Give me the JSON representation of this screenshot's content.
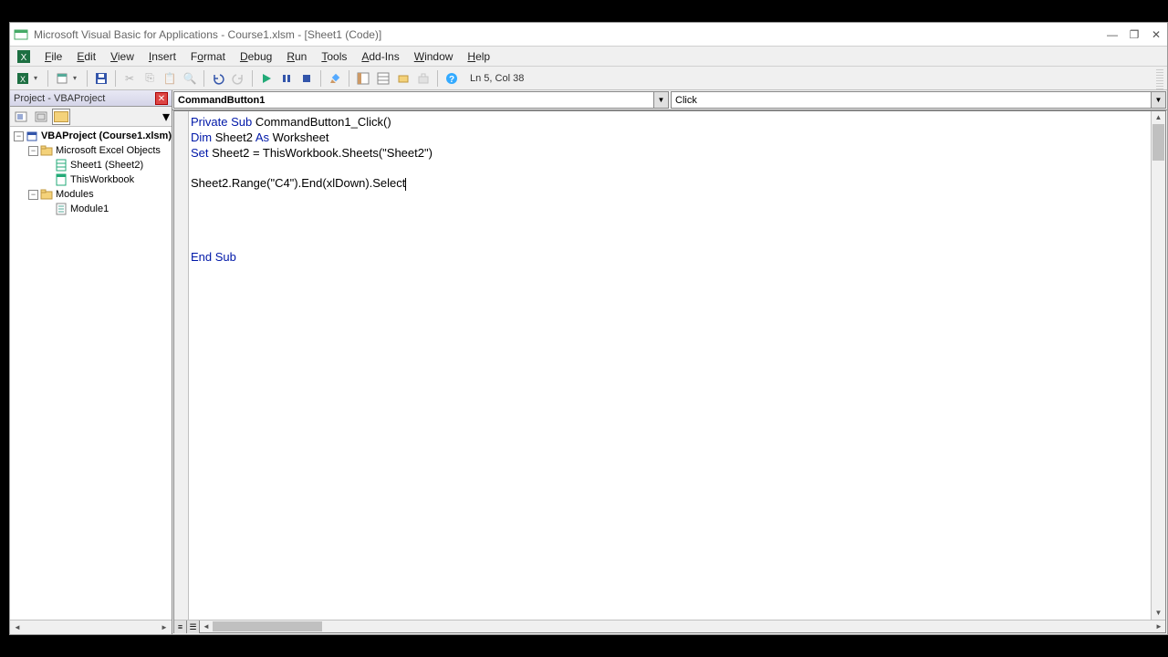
{
  "title": "Microsoft Visual Basic for Applications - Course1.xlsm - [Sheet1 (Code)]",
  "menus": {
    "file": "File",
    "edit": "Edit",
    "view": "View",
    "insert": "Insert",
    "format": "Format",
    "debug": "Debug",
    "run": "Run",
    "tools": "Tools",
    "addins": "Add-Ins",
    "window": "Window",
    "help": "Help"
  },
  "toolbar": {
    "cursor_status": "Ln 5, Col 38"
  },
  "project_panel": {
    "title": "Project - VBAProject",
    "root": "VBAProject (Course1.xlsm)",
    "excel_objects": "Microsoft Excel Objects",
    "sheet1": "Sheet1 (Sheet2)",
    "thisworkbook": "ThisWorkbook",
    "modules": "Modules",
    "module1": "Module1"
  },
  "combos": {
    "object": "CommandButton1",
    "procedure": "Click"
  },
  "code": {
    "l1_kw1": "Private Sub",
    "l1_rest": " CommandButton1_Click()",
    "l2_kw1": "Dim",
    "l2_mid": " Sheet2 ",
    "l2_kw2": "As",
    "l2_rest": " Worksheet",
    "l3_kw1": "Set",
    "l3_rest": " Sheet2 = ThisWorkbook.Sheets(\"Sheet2\")",
    "l5": "Sheet2.Range(\"C4\").End(xlDown).Select",
    "l10_kw": "End Sub"
  }
}
